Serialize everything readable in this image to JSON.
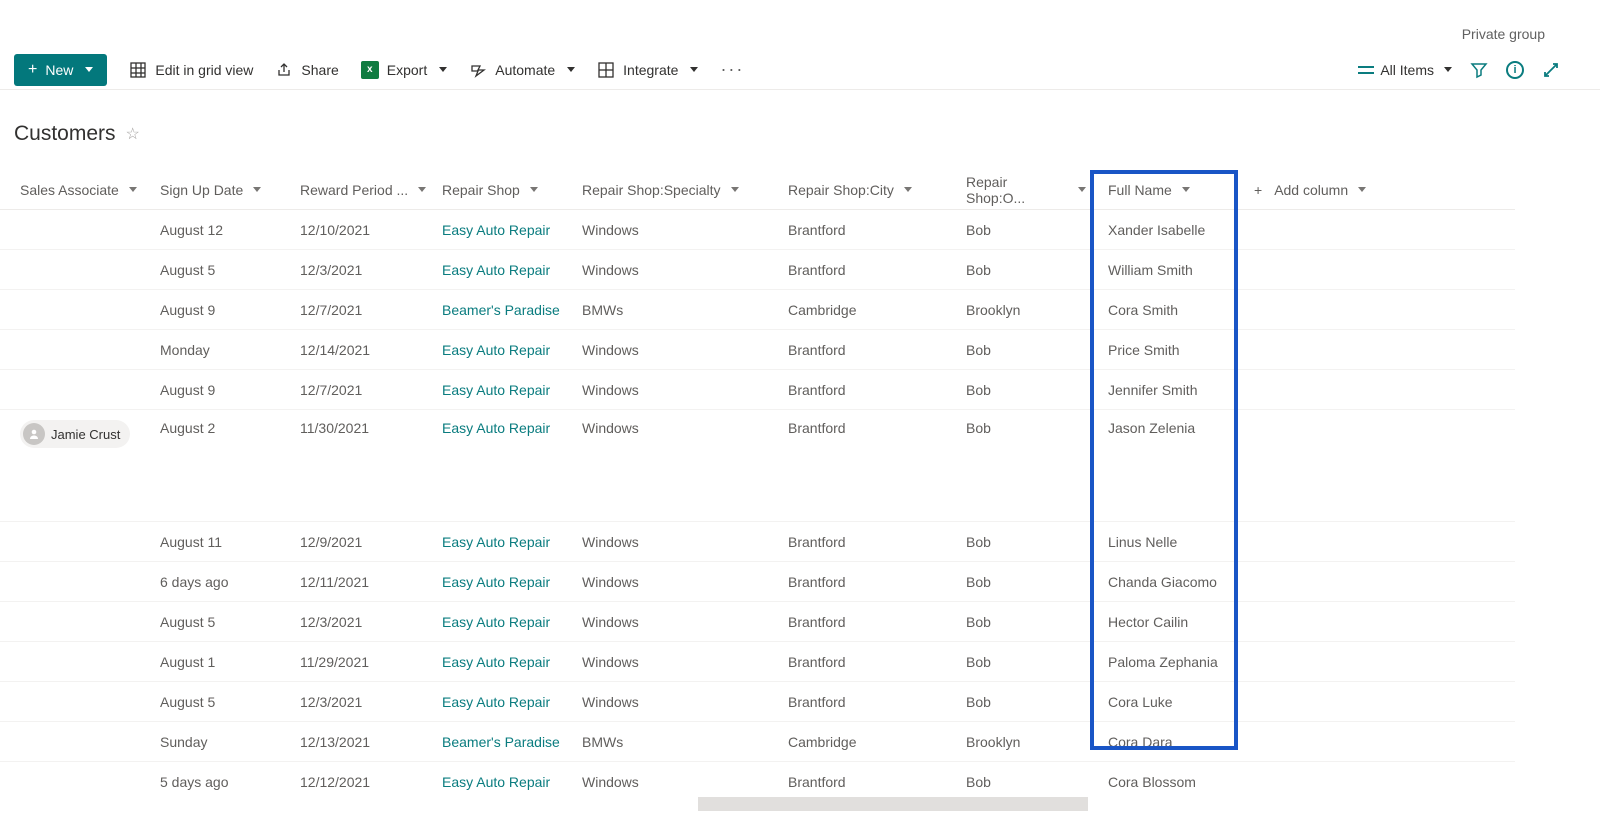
{
  "header": {
    "private_group": "Private group"
  },
  "toolbar": {
    "new_label": "New",
    "edit_grid_label": "Edit in grid view",
    "share_label": "Share",
    "export_label": "Export",
    "automate_label": "Automate",
    "integrate_label": "Integrate",
    "view_label": "All Items"
  },
  "page": {
    "title": "Customers"
  },
  "columns": {
    "sales_associate": "Sales Associate",
    "sign_up": "Sign Up Date",
    "reward": "Reward Period ...",
    "shop": "Repair Shop",
    "specialty": "Repair Shop:Specialty",
    "city": "Repair Shop:City",
    "owner": "Repair Shop:O...",
    "full_name": "Full Name",
    "add_column": "Add column"
  },
  "rows": [
    {
      "assoc": "",
      "sign_up": "August 12",
      "reward": "12/10/2021",
      "shop": "Easy Auto Repair",
      "spec": "Windows",
      "city": "Brantford",
      "owner": "Bob",
      "name": "Xander Isabelle"
    },
    {
      "assoc": "",
      "sign_up": "August 5",
      "reward": "12/3/2021",
      "shop": "Easy Auto Repair",
      "spec": "Windows",
      "city": "Brantford",
      "owner": "Bob",
      "name": "William Smith"
    },
    {
      "assoc": "",
      "sign_up": "August 9",
      "reward": "12/7/2021",
      "shop": "Beamer's Paradise",
      "spec": "BMWs",
      "city": "Cambridge",
      "owner": "Brooklyn",
      "name": "Cora Smith"
    },
    {
      "assoc": "",
      "sign_up": "Monday",
      "reward": "12/14/2021",
      "shop": "Easy Auto Repair",
      "spec": "Windows",
      "city": "Brantford",
      "owner": "Bob",
      "name": "Price Smith"
    },
    {
      "assoc": "",
      "sign_up": "August 9",
      "reward": "12/7/2021",
      "shop": "Easy Auto Repair",
      "spec": "Windows",
      "city": "Brantford",
      "owner": "Bob",
      "name": "Jennifer Smith"
    },
    {
      "assoc": "Jamie Crust",
      "sign_up": "August 2",
      "reward": "11/30/2021",
      "shop": "Easy Auto Repair",
      "spec": "Windows",
      "city": "Brantford",
      "owner": "Bob",
      "name": "Jason Zelenia",
      "tall": true
    },
    {
      "assoc": "",
      "sign_up": "August 11",
      "reward": "12/9/2021",
      "shop": "Easy Auto Repair",
      "spec": "Windows",
      "city": "Brantford",
      "owner": "Bob",
      "name": "Linus Nelle"
    },
    {
      "assoc": "",
      "sign_up": "6 days ago",
      "reward": "12/11/2021",
      "shop": "Easy Auto Repair",
      "spec": "Windows",
      "city": "Brantford",
      "owner": "Bob",
      "name": "Chanda Giacomo"
    },
    {
      "assoc": "",
      "sign_up": "August 5",
      "reward": "12/3/2021",
      "shop": "Easy Auto Repair",
      "spec": "Windows",
      "city": "Brantford",
      "owner": "Bob",
      "name": "Hector Cailin"
    },
    {
      "assoc": "",
      "sign_up": "August 1",
      "reward": "11/29/2021",
      "shop": "Easy Auto Repair",
      "spec": "Windows",
      "city": "Brantford",
      "owner": "Bob",
      "name": "Paloma Zephania"
    },
    {
      "assoc": "",
      "sign_up": "August 5",
      "reward": "12/3/2021",
      "shop": "Easy Auto Repair",
      "spec": "Windows",
      "city": "Brantford",
      "owner": "Bob",
      "name": "Cora Luke"
    },
    {
      "assoc": "",
      "sign_up": "Sunday",
      "reward": "12/13/2021",
      "shop": "Beamer's Paradise",
      "spec": "BMWs",
      "city": "Cambridge",
      "owner": "Brooklyn",
      "name": "Cora Dara"
    },
    {
      "assoc": "",
      "sign_up": "5 days ago",
      "reward": "12/12/2021",
      "shop": "Easy Auto Repair",
      "spec": "Windows",
      "city": "Brantford",
      "owner": "Bob",
      "name": "Cora Blossom"
    }
  ]
}
